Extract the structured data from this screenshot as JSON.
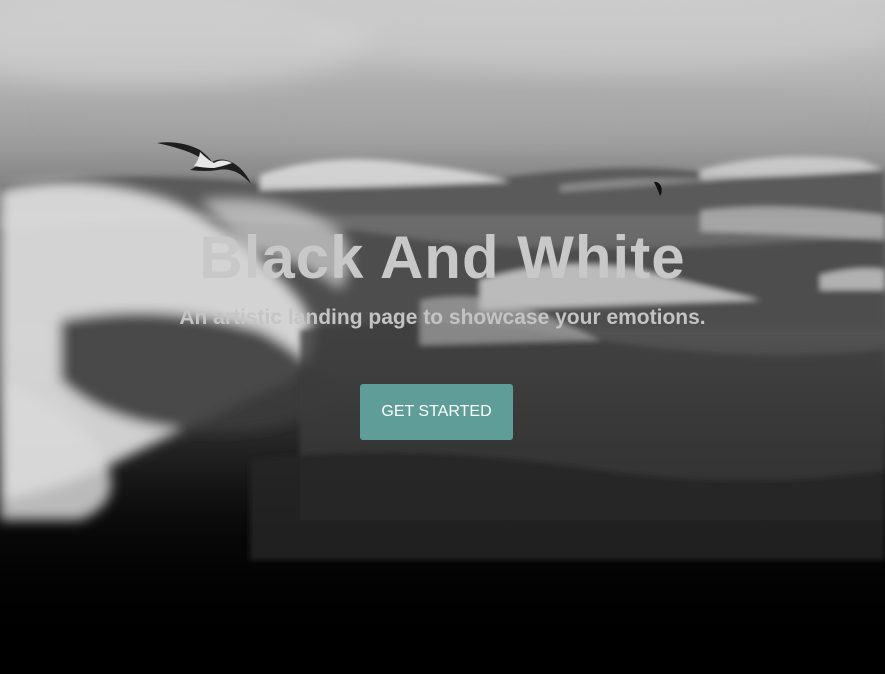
{
  "hero": {
    "title": "Black And White",
    "subtitle": "An artistic landing page to showcase your emotions.",
    "cta_label": "GET STARTED"
  },
  "colors": {
    "cta_background": "#5f9e98",
    "cta_text": "#ffffff",
    "title_text": "#c8c8c8",
    "subtitle_text": "#c4c4c4"
  },
  "background": {
    "description_icon": "ocean-waves-photo",
    "birds": [
      "seagull-icon",
      "distant-bird-icon"
    ]
  }
}
